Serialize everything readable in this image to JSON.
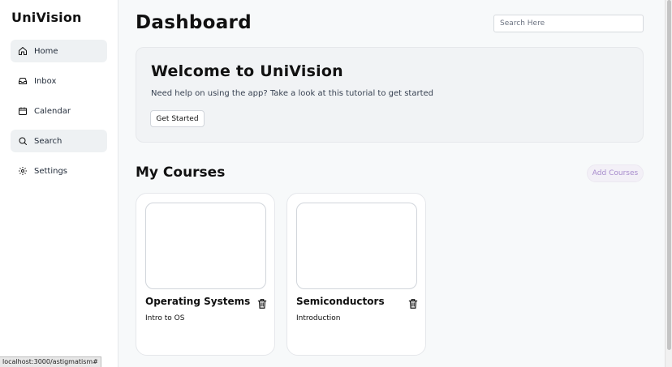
{
  "app": {
    "brand": "UniVision"
  },
  "sidebar": {
    "items": [
      {
        "label": "Home",
        "icon": "home-icon",
        "active": true
      },
      {
        "label": "Inbox",
        "icon": "inbox-icon",
        "active": false
      },
      {
        "label": "Calendar",
        "icon": "calendar-icon",
        "active": false
      },
      {
        "label": "Search",
        "icon": "search-icon",
        "active": true
      },
      {
        "label": "Settings",
        "icon": "gear-icon",
        "active": false
      }
    ]
  },
  "header": {
    "title": "Dashboard",
    "search_placeholder": "Search Here"
  },
  "welcome": {
    "title": "Welcome to UniVision",
    "subtitle": "Need help on using the app? Take a look at this tutorial to get started",
    "button": "Get Started"
  },
  "courses": {
    "title": "My Courses",
    "add_button": "Add Courses",
    "items": [
      {
        "name": "Operating Systems",
        "subtitle": "Intro to OS"
      },
      {
        "name": "Semiconductors",
        "subtitle": "Introduction"
      }
    ]
  },
  "status_bar": {
    "url": "localhost:3000/astigmatism#"
  },
  "colors": {
    "accent_text": "#a78bcc",
    "accent_bg": "#f3f0f7",
    "active_nav": "#eef1f3"
  }
}
